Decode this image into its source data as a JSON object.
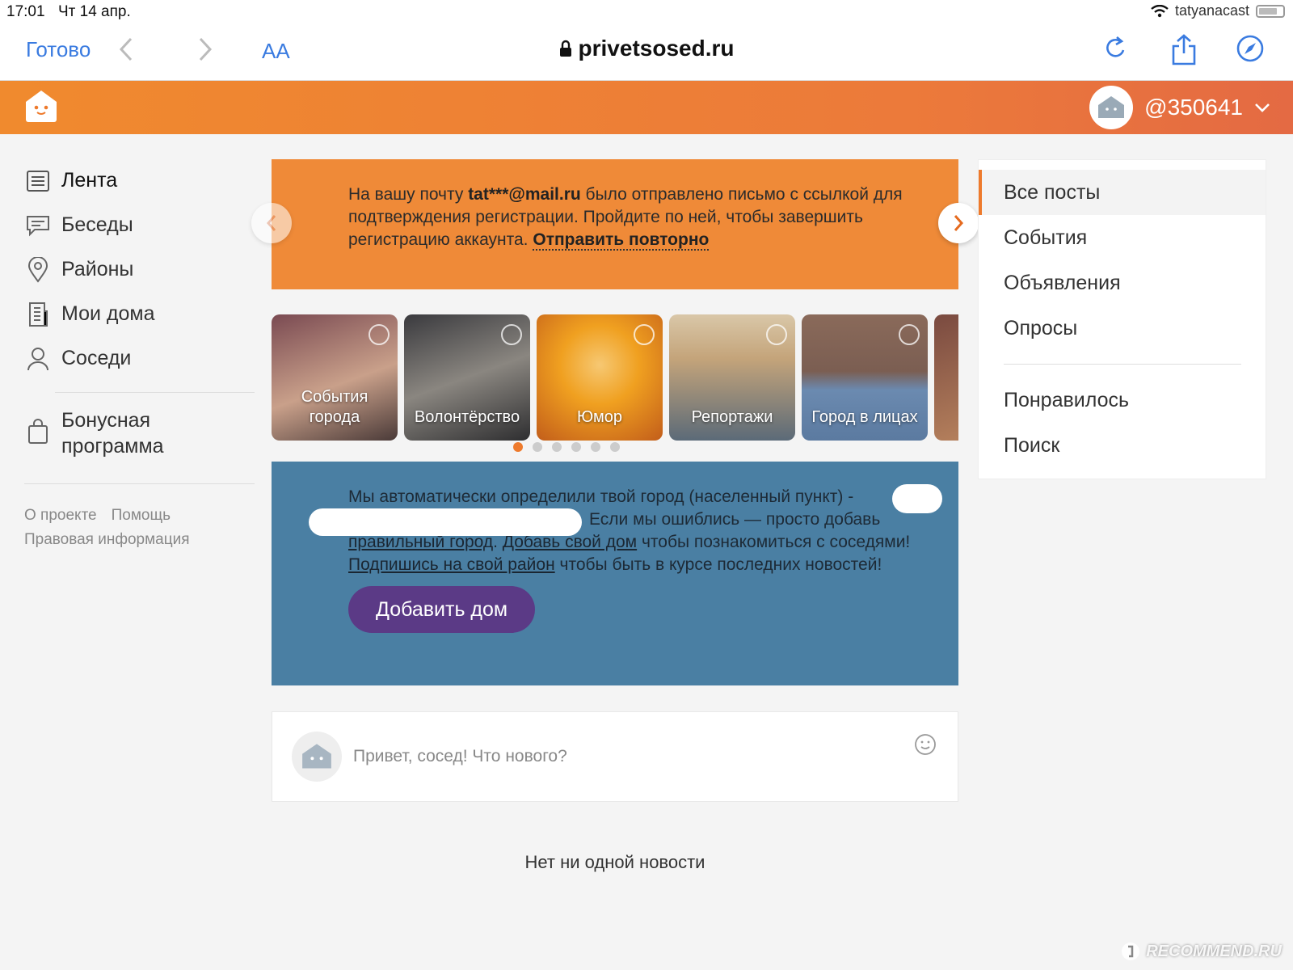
{
  "status_bar": {
    "time": "17:01",
    "date": "Чт 14 апр.",
    "username": "tatyanacast"
  },
  "browser": {
    "done_label": "Готово",
    "text_size_label": "AA",
    "url": "privetsosed.ru"
  },
  "header": {
    "username": "@350641"
  },
  "sidebar": {
    "items": [
      {
        "label": "Лента",
        "icon": "feed-icon"
      },
      {
        "label": "Беседы",
        "icon": "chat-icon"
      },
      {
        "label": "Районы",
        "icon": "location-pin-icon"
      },
      {
        "label": "Мои дома",
        "icon": "building-icon"
      },
      {
        "label": "Соседи",
        "icon": "person-icon"
      }
    ],
    "bonus_line1": "Бонусная",
    "bonus_line2": "программа",
    "footer": {
      "about": "О проекте",
      "help": "Помощь",
      "legal": "Правовая информация"
    }
  },
  "notice": {
    "before": "На вашу почту ",
    "email": "tat***@mail.ru",
    "after": " было отправлено письмо с ссылкой для подтверждения регистрации. Пройдите по ней, чтобы завершить регистрацию аккаунта. ",
    "resend": "Отправить повторно"
  },
  "carousel": {
    "cards": [
      {
        "line1": "События",
        "line2": "города",
        "color1": "#7a4a52",
        "color2": "#c9a08a"
      },
      {
        "line1": "Волонтёрство",
        "line2": "",
        "color1": "#3a3a3e",
        "color2": "#8a8680"
      },
      {
        "line1": "Юмор",
        "line2": "",
        "color1": "#f0a020",
        "color2": "#c25d1a"
      },
      {
        "line1": "Репортажи",
        "line2": "",
        "color1": "#c4a47a",
        "color2": "#5b6a78"
      },
      {
        "line1": "Город в лицах",
        "line2": "",
        "color1": "#8a6a5a",
        "color2": "#6b8ab0"
      }
    ],
    "active_dot": 0,
    "dot_count": 6
  },
  "city": {
    "line1": "Мы автоматически определили твой город (населенный пункт) -",
    "line2_after": "Если мы ошиблись — просто добавь",
    "link_city": "правильный город",
    "link_home": "Добавь свой дом",
    "mid": " чтобы познакомиться с соседями! ",
    "link_district": "Подпишись на свой район",
    "end": " чтобы быть в курсе последних новостей!",
    "button": "Добавить дом"
  },
  "composer": {
    "placeholder": "Привет, сосед! Что нового?"
  },
  "feed": {
    "empty": "Нет ни одной новости"
  },
  "filters": {
    "items": [
      "Все посты",
      "События",
      "Объявления",
      "Опросы"
    ],
    "secondary": [
      "Понравилось",
      "Поиск"
    ]
  },
  "watermark": "RECOMMEND.RU",
  "colors": {
    "accent": "#ee7a2c",
    "city_bg": "#4a7fa3",
    "button": "#5b3a86",
    "ios_blue": "#3a7be0"
  }
}
